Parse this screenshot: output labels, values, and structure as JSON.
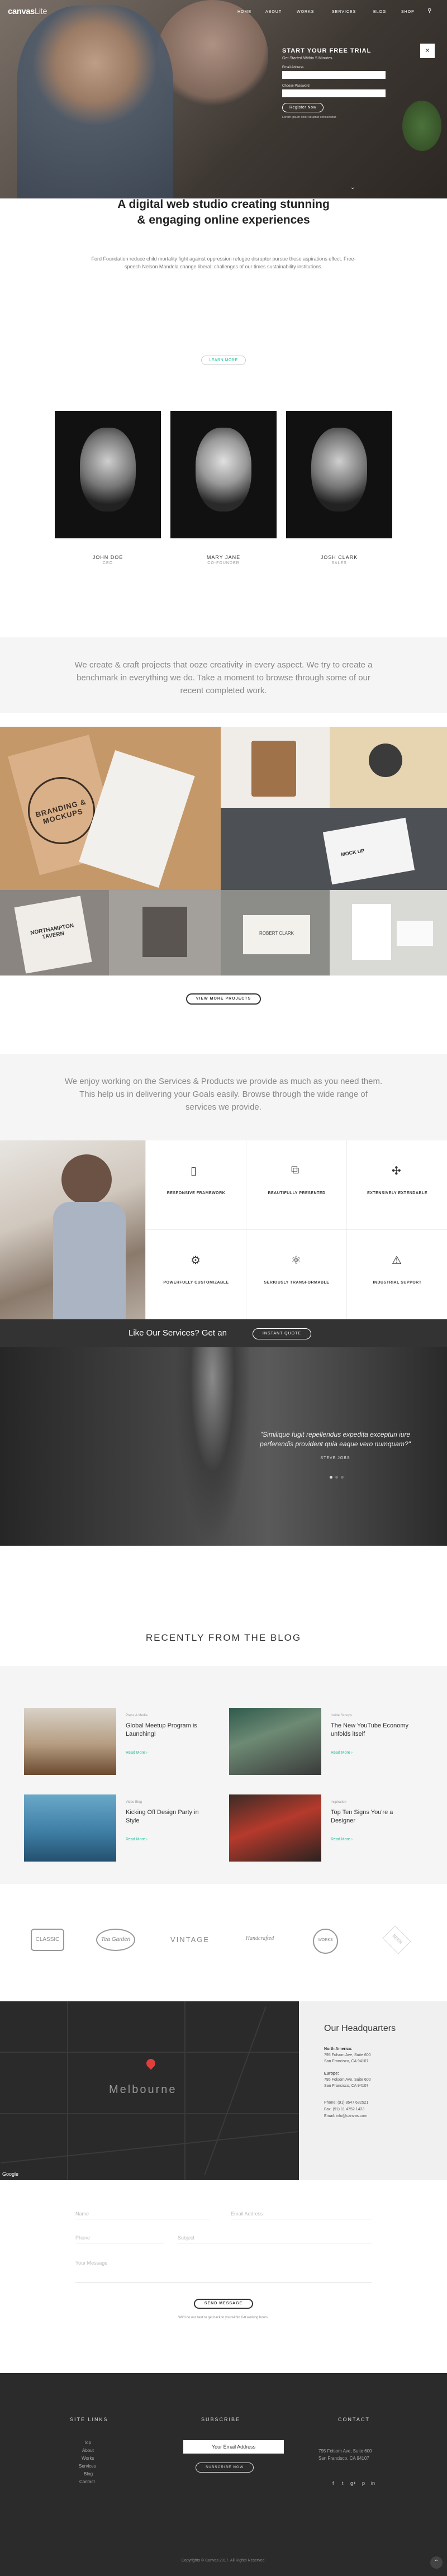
{
  "header": {
    "logo_main": "canvas",
    "logo_suffix": "Lite",
    "nav": [
      "HOME",
      "ABOUT",
      "WORKS",
      "SERVICES",
      "BLOG",
      "SHOP"
    ],
    "search_icon": "search-icon"
  },
  "trial": {
    "title": "START YOUR FREE TRIAL",
    "subtitle": "Get Started Within 5 Minutes.",
    "email_label": "Email Address",
    "password_label": "Choose Password",
    "register": "Register Now",
    "note": "Lorem ipsum dolor sit amet consectetur.",
    "close": "✕"
  },
  "intro": {
    "title_line1": "A digital web studio creating stunning",
    "title_line2": "& engaging online experiences",
    "text": "Ford Foundation reduce child mortality fight against oppression refugee disruptor pursue these aspirations effect. Free-speech Nelson Mandela change liberal; challenges of our times sustainability institutions.",
    "learn_more": "LEARN MORE"
  },
  "team": [
    {
      "name": "JOHN DOE",
      "role": "CEO"
    },
    {
      "name": "MARY JANE",
      "role": "CO-FOUNDER"
    },
    {
      "name": "JOSH CLARK",
      "role": "SALES"
    }
  ],
  "creative": {
    "text": "We create & craft projects that ooze creativity in every aspect. We try to create a benchmark in everything we do. Take a moment to browse through some of our recent completed work."
  },
  "portfolio": {
    "view_projects": "VIEW MORE PROJECTS",
    "branding_text": "BRANDING & MOCKUPS",
    "tavern_text": "NORTHAMPTON TAVERN",
    "mockup_text": "MOCK UP",
    "letter_text": "ROBERT CLARK"
  },
  "services": {
    "intro": "We enjoy working on the Services & Products we provide as much as you need them. This help us in delivering your Goals easily. Browse through the wide range of services we provide.",
    "items": [
      {
        "label": "RESPONSIVE FRAMEWORK",
        "icon": "tablet-icon",
        "glyph": "▯"
      },
      {
        "label": "BEAUTIFULLY PRESENTED",
        "icon": "presentation-icon",
        "glyph": "⧉"
      },
      {
        "label": "EXTENSIVELY EXTENDABLE",
        "icon": "puzzle-icon",
        "glyph": "✣"
      },
      {
        "label": "POWERFULLY CUSTOMIZABLE",
        "icon": "gears-icon",
        "glyph": "⚙"
      },
      {
        "label": "SERIOUSLY TRANSFORMABLE",
        "icon": "atom-icon",
        "glyph": "⚛"
      },
      {
        "label": "INDUSTRIAL SUPPORT",
        "icon": "warning-icon",
        "glyph": "⚠"
      }
    ],
    "bar_text": "Like Our Services? Get an",
    "quote_button": "INSTANT QUOTE"
  },
  "testimonial": {
    "quote": "\"Similique fugit repellendus expedita excepturi iure perferendis provident quia eaque vero numquam?\"",
    "author": "STEVE JOBS"
  },
  "blog": {
    "title": "RECENTLY FROM THE BLOG",
    "posts": [
      {
        "category": "Press & Media",
        "title": "Global Meetup Program is Launching!",
        "read": "Read More ›"
      },
      {
        "category": "Inside Scoops",
        "title": "The New YouTube Economy unfolds itself",
        "read": "Read More ›"
      },
      {
        "category": "Video Blog",
        "title": "Kicking Off Design Party in Style",
        "read": "Read More ›"
      },
      {
        "category": "Inspiration",
        "title": "Top Ten Signs You're a Designer",
        "read": "Read More ›"
      }
    ],
    "logos": [
      "CLASSIC",
      "Tea Garden",
      "VINTAGE",
      "Handcrafted",
      "WORKS",
      "BEER"
    ]
  },
  "map": {
    "city": "Melbourne",
    "google": "Google"
  },
  "hq": {
    "title": "Our Headquarters",
    "na_label": "North America:",
    "na_line1": "795 Folsom Ave, Suite 600",
    "na_line2": "San Francisco, CA 94107",
    "eu_label": "Europe:",
    "eu_line1": "795 Folsom Ave, Suite 600",
    "eu_line2": "San Francisco, CA 94107",
    "phone": "Phone: (91) 8547 632521",
    "fax": "Fax: (91) 11 4752 1433",
    "email": "Email: info@canvas.com"
  },
  "contact": {
    "name": "Name",
    "email": "Email Address",
    "phone": "Phone",
    "subject": "Subject",
    "message": "Your Message",
    "send": "SEND MESSAGE",
    "note": "We'll do our best to get back to you within 6-8 working hours."
  },
  "footer": {
    "links_title": "SITE LINKS",
    "links": [
      "Top",
      "About",
      "Works",
      "Services",
      "Blog",
      "Contact"
    ],
    "subscribe_title": "SUBSCRIBE",
    "subscribe_placeholder": "Your Email Address",
    "subscribe_button": "SUBSCRIBE NOW",
    "contact_title": "CONTACT",
    "contact_line1": "795 Folsom Ave, Suite 600",
    "contact_line2": "San Francisco, CA 94107",
    "social": [
      "f",
      "t",
      "g+",
      "p",
      "in"
    ],
    "copyright": "Copyrights © Canvas 2017. All Rights Reserved.",
    "totop": "⌃"
  }
}
